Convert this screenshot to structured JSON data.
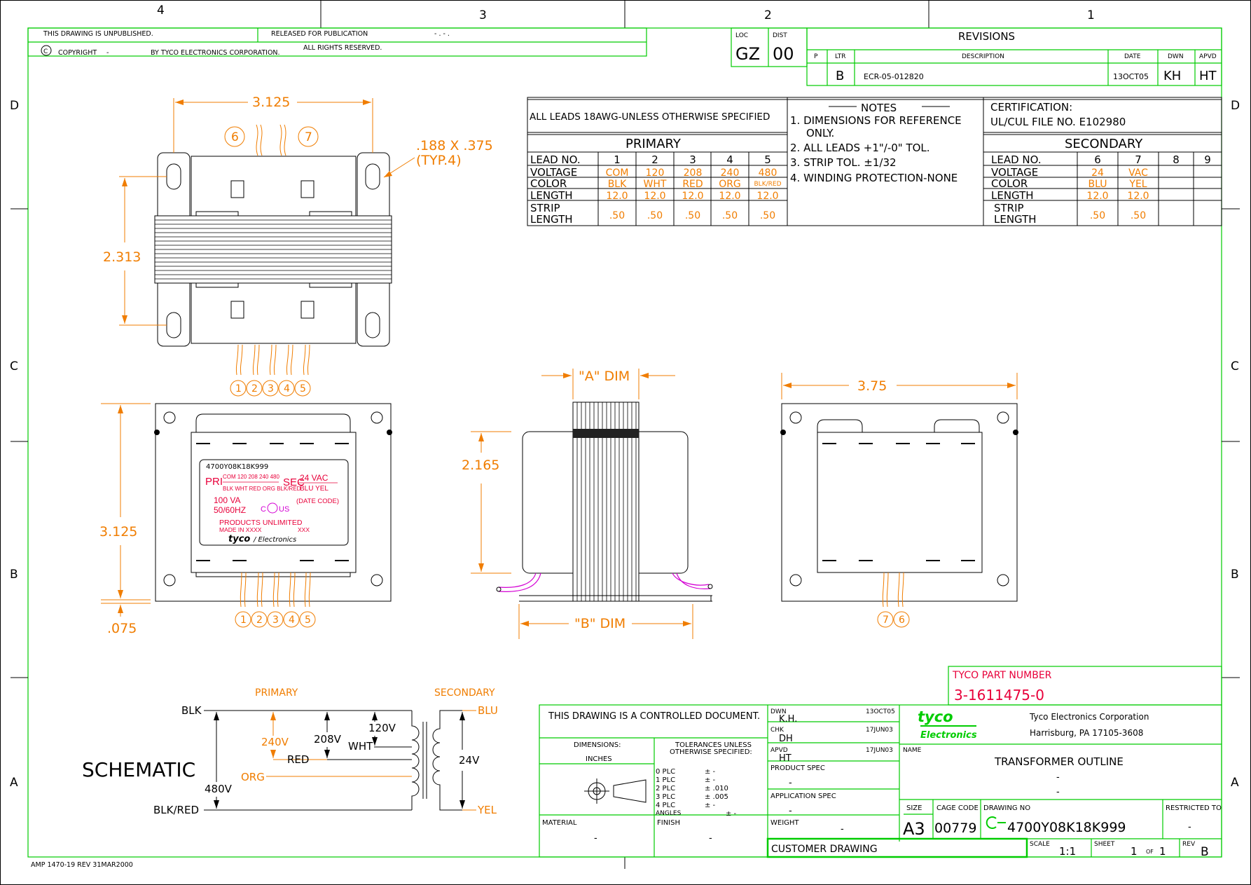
{
  "zones": {
    "top": [
      "4",
      "3",
      "2",
      "1"
    ],
    "side": [
      "D",
      "C",
      "B",
      "A"
    ]
  },
  "header": {
    "unpublished": "THIS DRAWING IS UNPUBLISHED.",
    "released": "RELEASED FOR PUBLICATION",
    "released_dash": "- . -    .",
    "copyright": "COPYRIGHT",
    "copyright_dash": "-",
    "by": "BY TYCO ELECTRONICS CORPORATION.",
    "rights": "ALL RIGHTS RESERVED.",
    "loc_label": "LOC",
    "loc": "GZ",
    "dist_label": "DIST",
    "dist": "00"
  },
  "revisions": {
    "title": "REVISIONS",
    "headers": [
      "P",
      "LTR",
      "DESCRIPTION",
      "DATE",
      "DWN",
      "APVD"
    ],
    "row": {
      "ltr": "B",
      "description": "ECR-05-012820",
      "date": "13OCT05",
      "dwn": "KH",
      "apvd": "HT"
    }
  },
  "leads_note": "ALL LEADS 18AWG-UNLESS OTHERWISE SPECIFIED",
  "notes": {
    "title": "NOTES",
    "items": [
      "1. DIMENSIONS FOR REFERENCE",
      "ONLY.",
      "2. ALL LEADS +1\"/-0\" TOL.",
      "3. STRIP TOL. ±1/32",
      "4. WINDING PROTECTION-NONE"
    ]
  },
  "certification": {
    "label": "CERTIFICATION:",
    "file": "UL/CUL FILE NO. E102980"
  },
  "primary": {
    "title": "PRIMARY",
    "row_labels": [
      "LEAD NO.",
      "VOLTAGE",
      "COLOR",
      "LENGTH",
      "STRIP",
      "LENGTH"
    ],
    "leads": [
      "1",
      "2",
      "3",
      "4",
      "5"
    ],
    "voltage": [
      "COM",
      "120",
      "208",
      "240",
      "480"
    ],
    "color": [
      "BLK",
      "WHT",
      "RED",
      "ORG",
      "BLK/RED"
    ],
    "length": [
      "12.0",
      "12.0",
      "12.0",
      "12.0",
      "12.0"
    ],
    "strip": [
      ".50",
      ".50",
      ".50",
      ".50",
      ".50"
    ]
  },
  "secondary": {
    "title": "SECONDARY",
    "leads": [
      "6",
      "7",
      "8",
      "9"
    ],
    "voltage": [
      "24",
      "VAC",
      "",
      ""
    ],
    "color": [
      "BLU",
      "YEL",
      "",
      ""
    ],
    "length": [
      "12.0",
      "12.0",
      "",
      ""
    ],
    "strip": [
      ".50",
      ".50",
      "",
      ""
    ]
  },
  "dims": {
    "top_width": "3.125",
    "slot": ".188 X .375",
    "slot_typ": "(TYP.4)",
    "height1": "2.313",
    "height2": "3.125",
    "base": ".075",
    "a_dim": "\"A\" DIM",
    "b_dim": "\"B\" DIM",
    "side_h": "2.165",
    "right_w": "3.75",
    "top_leads_left": "6",
    "top_leads_right": "7",
    "lead_nums": [
      "1",
      "2",
      "3",
      "4",
      "5"
    ],
    "right_leads": [
      "7",
      "6"
    ]
  },
  "label": {
    "part": "4700Y08K18K999",
    "pri": "PRI",
    "pri_v": "COM 120 208 240 480",
    "pri_c": "BLK WHT RED ORG BLK/RED",
    "sec": "SEC",
    "sec_v": "24  VAC",
    "sec_c": "BLU   YEL",
    "va": "100 VA",
    "hz": "50/60HZ",
    "ul_c": "C",
    "ul_us": "US",
    "date_code": "(DATE CODE)",
    "products": "PRODUCTS UNLIMITED",
    "made_in": "MADE IN XXXX",
    "made_xxx": "XXX",
    "brand": "tyco",
    "brand2": "/ Electronics"
  },
  "schematic": {
    "title": "SCHEMATIC",
    "primary": "PRIMARY",
    "secondary": "SECONDARY",
    "blk": "BLK",
    "blkred": "BLK/RED",
    "red": "RED",
    "org": "ORG",
    "wht": "WHT",
    "v480": "480V",
    "v240": "240V",
    "v208": "208V",
    "v120": "120V",
    "blu": "BLU",
    "yel": "YEL",
    "v24": "24V"
  },
  "title_block": {
    "part_label": "TYCO PART NUMBER",
    "part_number": "3-1611475-0",
    "controlled": "THIS DRAWING IS A CONTROLLED DOCUMENT.",
    "dwn_label": "DWN",
    "dwn": "K.H.",
    "dwn_date": "13OCT05",
    "chk_label": "CHK",
    "chk": "DH",
    "chk_date": "17JUN03",
    "apvd_label": "APVD",
    "apvd": "HT",
    "apvd_date": "17JUN03",
    "product_spec": "PRODUCT SPEC",
    "application_spec": "APPLICATION SPEC",
    "weight": "WEIGHT",
    "dash": "-",
    "dimensions": "DIMENSIONS:",
    "inches": "INCHES",
    "tolerances": "TOLERANCES UNLESS",
    "otherwise": "OTHERWISE SPECIFIED:",
    "plc": [
      "0  PLC",
      "1  PLC",
      "2  PLC",
      "3  PLC",
      "4  PLC",
      "ANGLES"
    ],
    "plc_val": [
      "±  -",
      "±  -",
      "± .010",
      "± .005",
      "±  -",
      "±  -"
    ],
    "material": "MATERIAL",
    "finish": "FINISH",
    "company": "Tyco Electronics Corporation",
    "address": "Harrisburg,  PA  17105-3608",
    "logo1": "tyco",
    "logo2": "Electronics",
    "name_label": "NAME",
    "name": "TRANSFORMER OUTLINE",
    "size_label": "SIZE",
    "size": "A3",
    "cage_label": "CAGE CODE",
    "cage": "00779",
    "dwg_label": "DRAWING NO",
    "dwg": "4700Y08K18K999",
    "restricted": "RESTRICTED TO",
    "customer": "CUSTOMER DRAWING",
    "scale_label": "SCALE",
    "scale": "1:1",
    "sheet_label": "SHEET",
    "sheet": "1",
    "of": "OF",
    "sheets": "1",
    "rev_label": "REV",
    "rev": "B"
  },
  "footer": "AMP 1470-19  REV 31MAR2000"
}
